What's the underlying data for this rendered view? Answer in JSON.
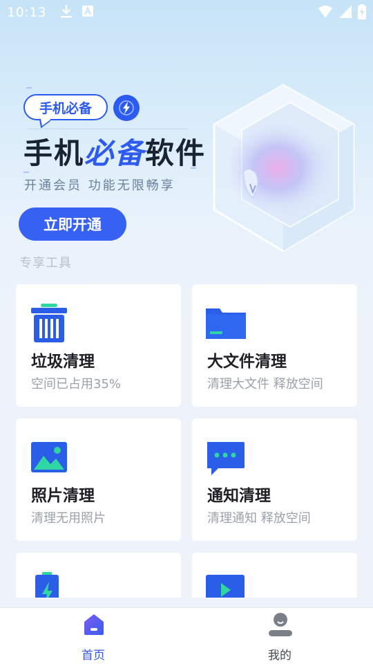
{
  "status_bar": {
    "time": "10:13"
  },
  "promo": {
    "tag": "手机必备",
    "title_part1": "手机",
    "title_highlight": "必备",
    "title_part2": "软件",
    "subtitle": "开通会员 功能无限畅享",
    "button_label": "立即开通"
  },
  "section_title": "专享工具",
  "tools": [
    {
      "title": "垃圾清理",
      "desc": "空间已占用35%",
      "icon": "trash-bin-icon"
    },
    {
      "title": "大文件清理",
      "desc": "清理大文件 释放空间",
      "icon": "folder-icon"
    },
    {
      "title": "照片清理",
      "desc": "清理无用照片",
      "icon": "image-icon"
    },
    {
      "title": "通知清理",
      "desc": "清理通知 释放空间",
      "icon": "message-bubble-icon"
    },
    {
      "title": "",
      "desc": "",
      "icon": "battery-bolt-icon"
    },
    {
      "title": "",
      "desc": "",
      "icon": "video-play-icon"
    }
  ],
  "tab_bar": {
    "home_label": "首页",
    "me_label": "我的"
  },
  "colors": {
    "accent": "#3761f3",
    "active_tab": "#3055e8"
  }
}
